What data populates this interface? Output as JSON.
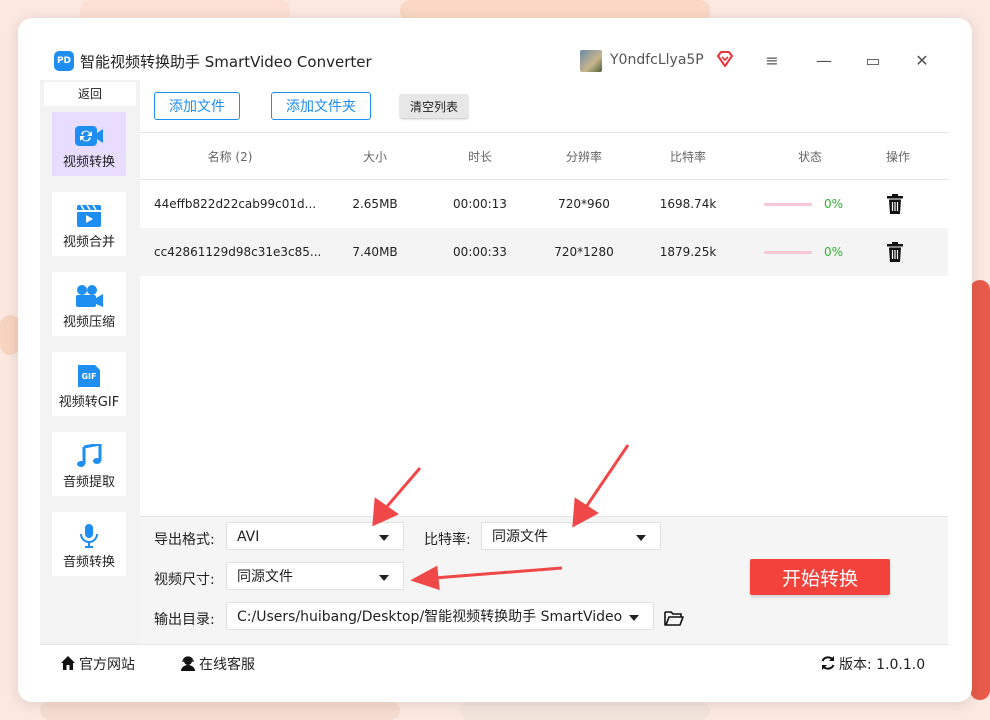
{
  "app": {
    "title": "智能视频转换助手 SmartVideo Converter",
    "logo_text": "PD",
    "username": "Y0ndfcLlya5P"
  },
  "window_controls": {
    "menu": "≡",
    "minimize": "—",
    "maximize": "▭",
    "close": "✕"
  },
  "sidebar": {
    "back_label": "返回",
    "items": [
      {
        "label": "视频转换",
        "icon": "video-convert-icon"
      },
      {
        "label": "视频合并",
        "icon": "video-merge-icon"
      },
      {
        "label": "视频压缩",
        "icon": "video-compress-icon"
      },
      {
        "label": "视频转GIF",
        "icon": "gif-icon"
      },
      {
        "label": "音频提取",
        "icon": "music-note-icon"
      },
      {
        "label": "音频转换",
        "icon": "microphone-icon"
      }
    ]
  },
  "toolbar": {
    "add_file": "添加文件",
    "add_folder": "添加文件夹",
    "clear_list": "清空列表"
  },
  "table": {
    "headers": [
      "名称 (2)",
      "大小",
      "时长",
      "分辨率",
      "比特率",
      "状态",
      "操作"
    ],
    "rows": [
      {
        "name": "44effb822d22cab99c01d...",
        "size": "2.65MB",
        "duration": "00:00:13",
        "resolution": "720*960",
        "bitrate": "1698.74k",
        "progress": "0%"
      },
      {
        "name": "cc42861129d98c31e3c85...",
        "size": "7.40MB",
        "duration": "00:00:33",
        "resolution": "720*1280",
        "bitrate": "1879.25k",
        "progress": "0%"
      }
    ]
  },
  "settings": {
    "format_label": "导出格式:",
    "format_value": "AVI",
    "bitrate_label": "比特率:",
    "bitrate_value": "同源文件",
    "size_label": "视频尺寸:",
    "size_value": "同源文件",
    "output_label": "输出目录:",
    "output_value": "C:/Users/huibang/Desktop/智能视频转换助手 SmartVideo",
    "start_button": "开始转换"
  },
  "footer": {
    "website": "官方网站",
    "support": "在线客服",
    "version_label": "版本:",
    "version_value": "1.0.1.0"
  },
  "colors": {
    "accent": "#1f8ef1",
    "start": "#f3423b",
    "arrow": "#f04848",
    "active_side": "#e8dcff",
    "success": "#2db52d"
  }
}
